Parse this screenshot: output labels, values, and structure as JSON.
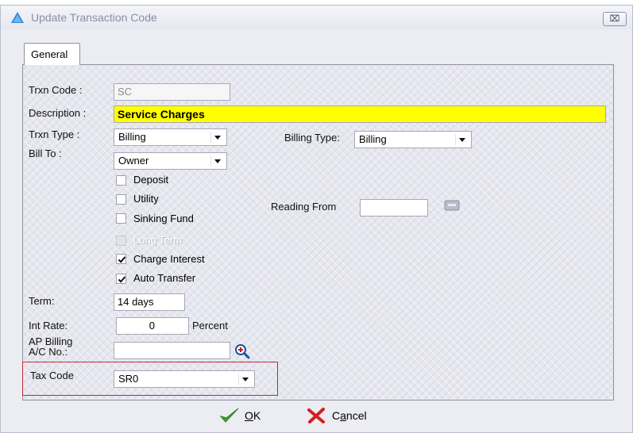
{
  "window": {
    "title": "Update Transaction Code",
    "close_label": "⌧"
  },
  "tabs": [
    {
      "label": "General"
    }
  ],
  "form": {
    "trxn_code": {
      "label": "Trxn Code :",
      "value": "SC"
    },
    "description": {
      "label": "Description :",
      "value": "Service Charges"
    },
    "trxn_type": {
      "label": "Trxn Type :",
      "value": "Billing"
    },
    "billing_type": {
      "label": "Billing Type:",
      "value": "Billing"
    },
    "bill_to": {
      "label": "Bill To :",
      "value": "Owner"
    },
    "checkboxes": [
      {
        "label": "Deposit",
        "checked": false,
        "enabled": true
      },
      {
        "label": "Utility",
        "checked": false,
        "enabled": true
      },
      {
        "label": "Sinking Fund",
        "checked": false,
        "enabled": true
      },
      {
        "label": "Long Term",
        "checked": false,
        "enabled": false
      },
      {
        "label": "Charge Interest",
        "checked": true,
        "enabled": true
      },
      {
        "label": "Auto Transfer",
        "checked": true,
        "enabled": true
      }
    ],
    "reading_from": {
      "label": "Reading From",
      "value": ""
    },
    "term": {
      "label": "Term:",
      "value": "14 days"
    },
    "int_rate": {
      "label": "Int Rate:",
      "value": "0",
      "unit": "Percent"
    },
    "ap_billing": {
      "label_line1": "AP Billing",
      "label_line2": "A/C No.:",
      "value": ""
    },
    "tax_code": {
      "label": "Tax Code",
      "value": "SR0"
    }
  },
  "buttons": {
    "ok": {
      "mnemonic": "O",
      "rest": "K"
    },
    "cancel": {
      "prefix": "C",
      "mnemonic": "a",
      "rest": "ncel"
    }
  },
  "colors": {
    "highlight_border": "#c0282e",
    "description_bg": "#ffff00",
    "ok_icon": "#3aa62a",
    "cancel_icon": "#d42020"
  },
  "icons": {
    "title": "triangle-app-icon",
    "lookup": "magnifier-plus-icon",
    "reading_lookup": "small-browse-icon"
  }
}
